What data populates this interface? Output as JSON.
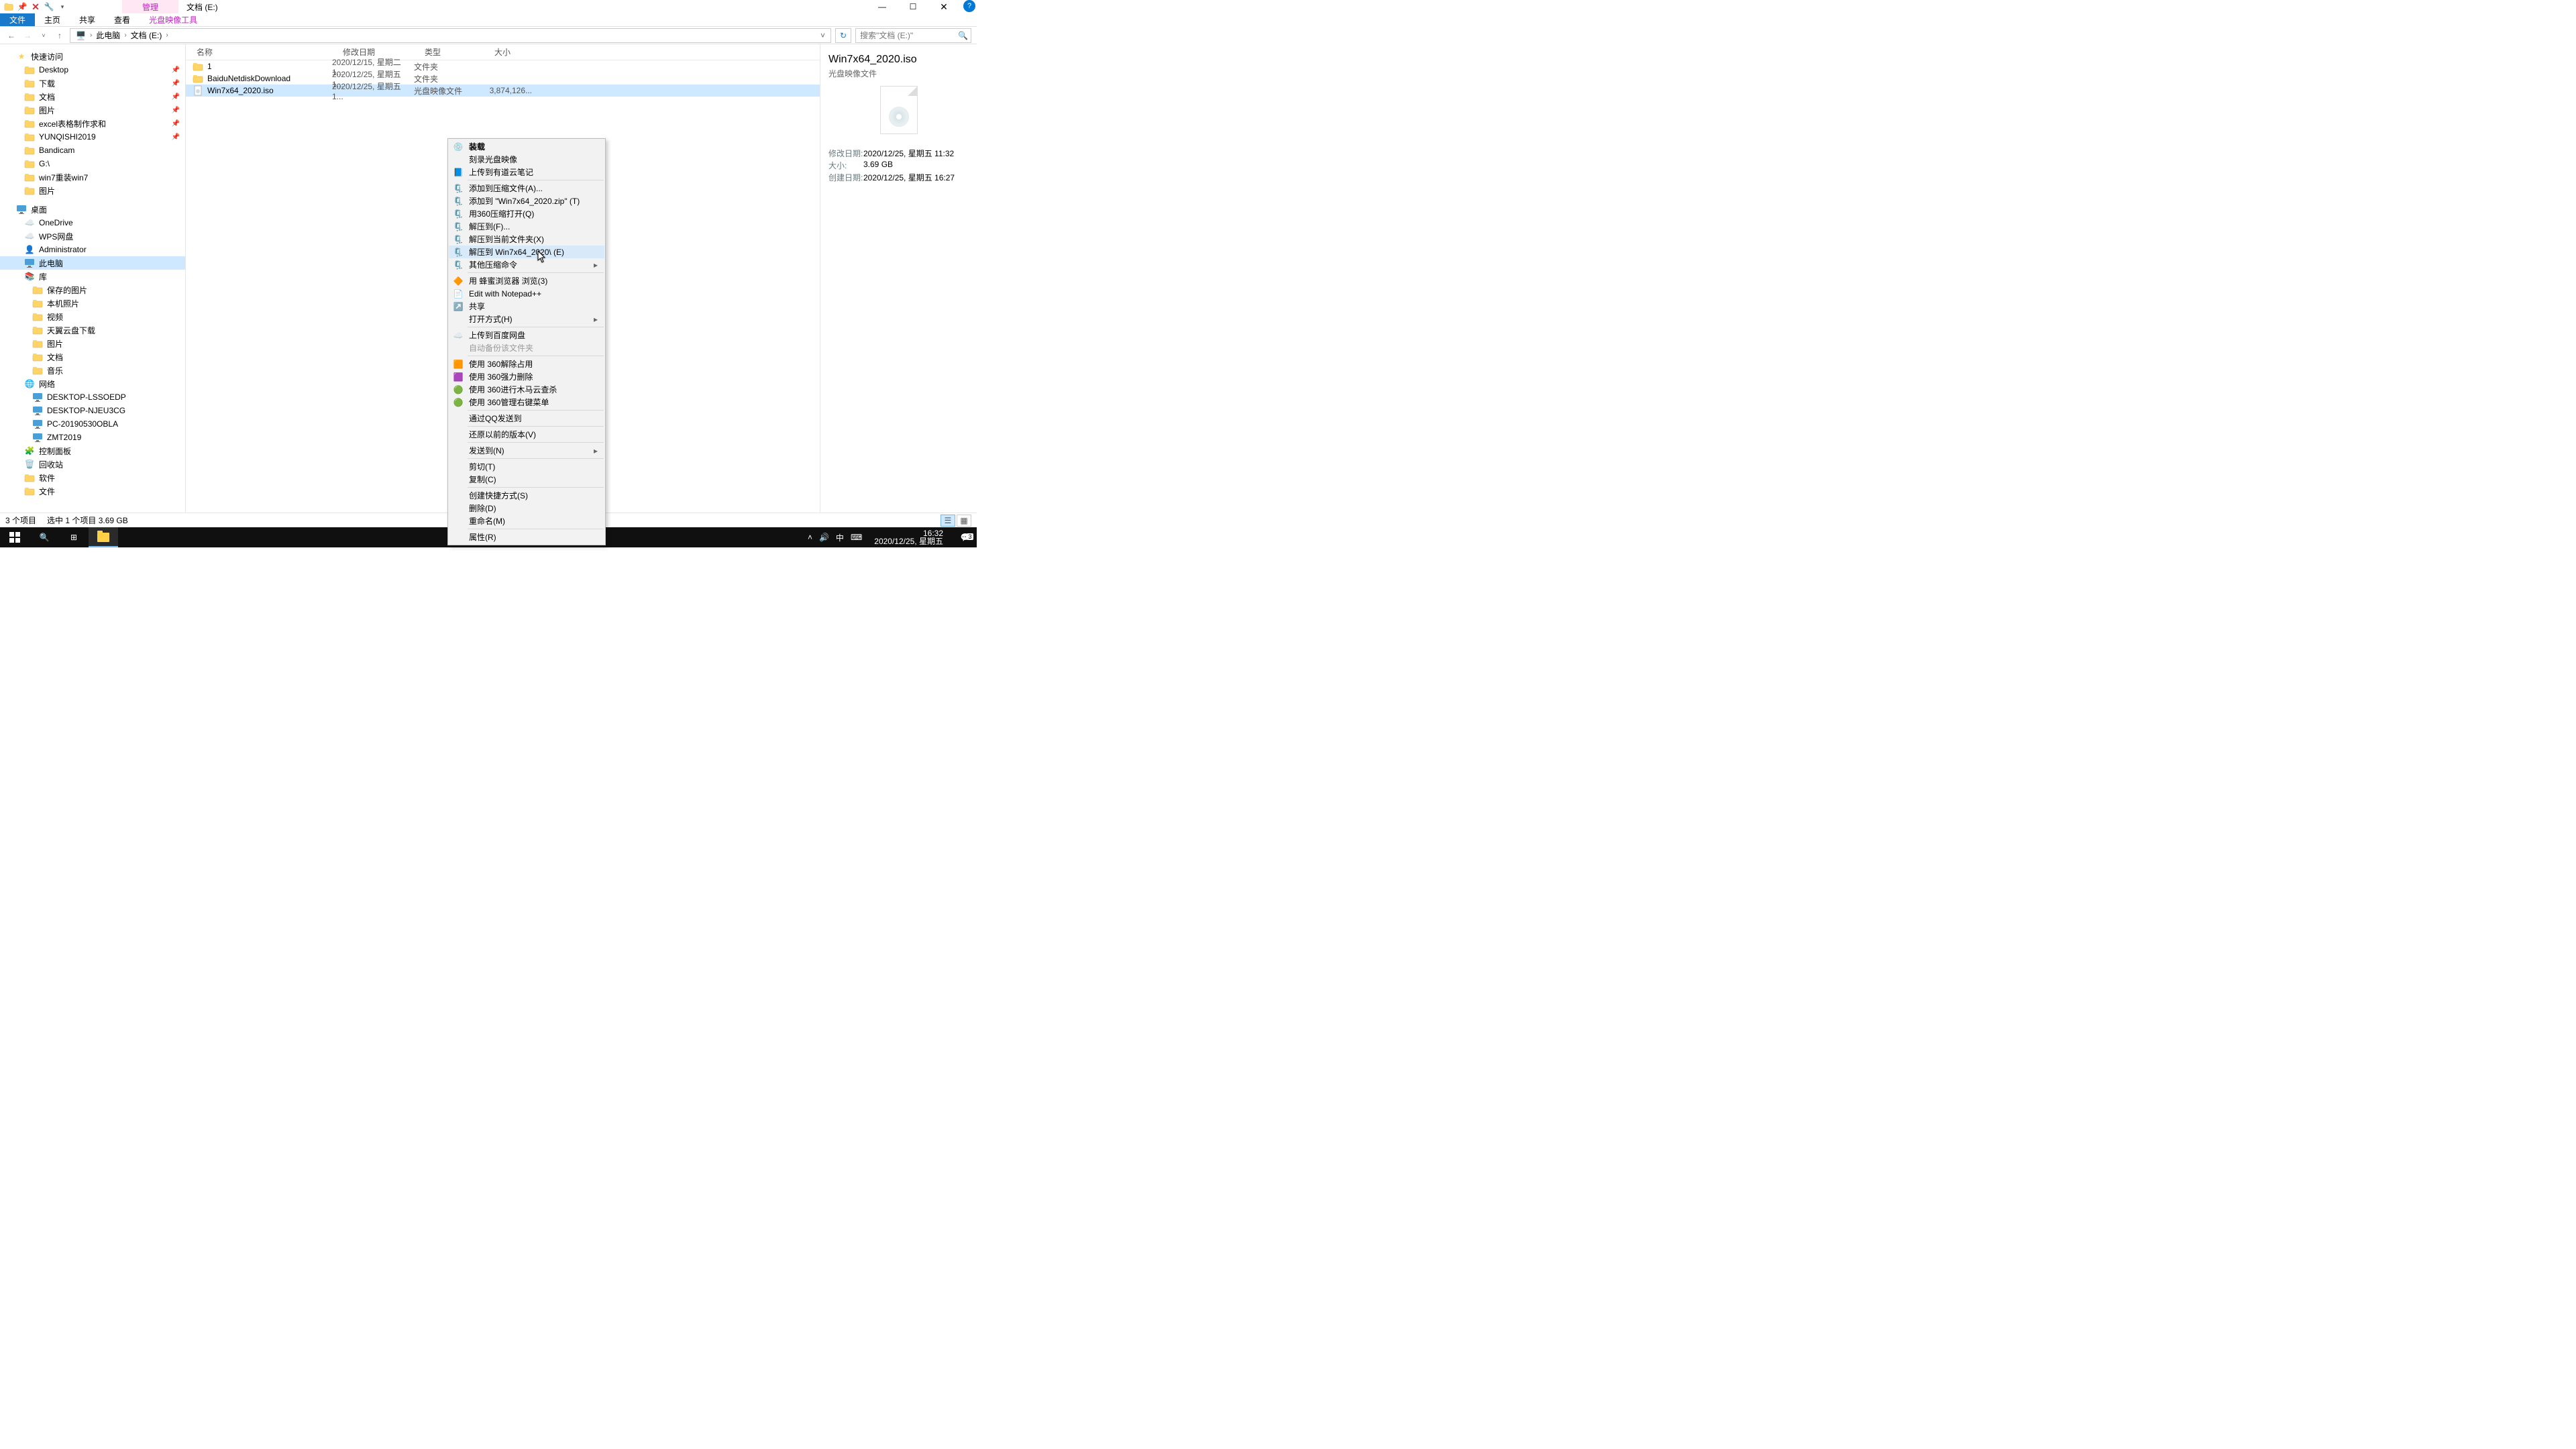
{
  "title_tab": "管理",
  "window_title": "文档 (E:)",
  "ribbon": {
    "file": "文件",
    "home": "主页",
    "share": "共享",
    "view": "查看",
    "tool": "光盘映像工具"
  },
  "breadcrumb": {
    "root": "此电脑",
    "drive": "文档 (E:)"
  },
  "search_placeholder": "搜索\"文档 (E:)\"",
  "tree": {
    "quick": "快速访问",
    "items_pinned": [
      "Desktop",
      "下载",
      "文档",
      "图片",
      "excel表格制作求和",
      "YUNQISHI2019"
    ],
    "items_recent": [
      "Bandicam",
      "G:\\",
      "win7重装win7",
      "图片"
    ],
    "desktop_root": "桌面",
    "desktop_items": [
      "OneDrive",
      "WPS网盘",
      "Administrator",
      "此电脑",
      "库"
    ],
    "lib_items": [
      "保存的图片",
      "本机照片",
      "视频",
      "天翼云盘下载",
      "图片",
      "文档",
      "音乐"
    ],
    "network": "网络",
    "net_items": [
      "DESKTOP-LSSOEDP",
      "DESKTOP-NJEU3CG",
      "PC-20190530OBLA",
      "ZMT2019"
    ],
    "bottom": [
      "控制面板",
      "回收站",
      "软件",
      "文件"
    ]
  },
  "columns": {
    "name": "名称",
    "date": "修改日期",
    "type": "类型",
    "size": "大小"
  },
  "rows": [
    {
      "name": "1",
      "date": "2020/12/15, 星期二 1...",
      "type": "文件夹",
      "size": ""
    },
    {
      "name": "BaiduNetdiskDownload",
      "date": "2020/12/25, 星期五 1...",
      "type": "文件夹",
      "size": ""
    },
    {
      "name": "Win7x64_2020.iso",
      "date": "2020/12/25, 星期五 1...",
      "type": "光盘映像文件",
      "size": "3,874,126..."
    }
  ],
  "menu": [
    {
      "t": "装载",
      "b": true,
      "ico": "disc"
    },
    {
      "t": "刻录光盘映像"
    },
    {
      "t": "上传到有道云笔记",
      "ico": "note"
    },
    {
      "sep": true
    },
    {
      "t": "添加到压缩文件(A)...",
      "ico": "zip"
    },
    {
      "t": "添加到 \"Win7x64_2020.zip\" (T)",
      "ico": "zip"
    },
    {
      "t": "用360压缩打开(Q)",
      "ico": "zip"
    },
    {
      "t": "解压到(F)...",
      "ico": "zip"
    },
    {
      "t": "解压到当前文件夹(X)",
      "ico": "zip"
    },
    {
      "t": "解压到 Win7x64_2020\\ (E)",
      "ico": "zip",
      "hov": true
    },
    {
      "t": "其他压缩命令",
      "ico": "zip",
      "sub": true
    },
    {
      "sep": true
    },
    {
      "t": "用 蜂蜜浏览器 浏览(3)",
      "ico": "bee"
    },
    {
      "t": "Edit with Notepad++",
      "ico": "npp"
    },
    {
      "t": "共享",
      "ico": "share"
    },
    {
      "t": "打开方式(H)",
      "sub": true
    },
    {
      "sep": true
    },
    {
      "t": "上传到百度网盘",
      "ico": "baidu"
    },
    {
      "t": "自动备份该文件夹",
      "dis": true
    },
    {
      "sep": true
    },
    {
      "t": "使用 360解除占用",
      "ico": "360o"
    },
    {
      "t": "使用 360强力删除",
      "ico": "360p"
    },
    {
      "t": "使用 360进行木马云查杀",
      "ico": "360g"
    },
    {
      "t": "使用 360管理右键菜单",
      "ico": "360g"
    },
    {
      "sep": true
    },
    {
      "t": "通过QQ发送到"
    },
    {
      "sep": true
    },
    {
      "t": "还原以前的版本(V)"
    },
    {
      "sep": true
    },
    {
      "t": "发送到(N)",
      "sub": true
    },
    {
      "sep": true
    },
    {
      "t": "剪切(T)"
    },
    {
      "t": "复制(C)"
    },
    {
      "sep": true
    },
    {
      "t": "创建快捷方式(S)"
    },
    {
      "t": "删除(D)"
    },
    {
      "t": "重命名(M)"
    },
    {
      "sep": true
    },
    {
      "t": "属性(R)"
    }
  ],
  "details": {
    "name": "Win7x64_2020.iso",
    "type": "光盘映像文件",
    "rows": [
      {
        "k": "修改日期:",
        "v": "2020/12/25, 星期五 11:32"
      },
      {
        "k": "大小:",
        "v": "3.69 GB"
      },
      {
        "k": "创建日期:",
        "v": "2020/12/25, 星期五 16:27"
      }
    ]
  },
  "status": {
    "count": "3 个项目",
    "sel": "选中 1 个项目  3.69 GB"
  },
  "clock": {
    "time": "16:32",
    "date": "2020/12/25, 星期五"
  },
  "tray": {
    "ime": "中",
    "notif_count": "3"
  }
}
